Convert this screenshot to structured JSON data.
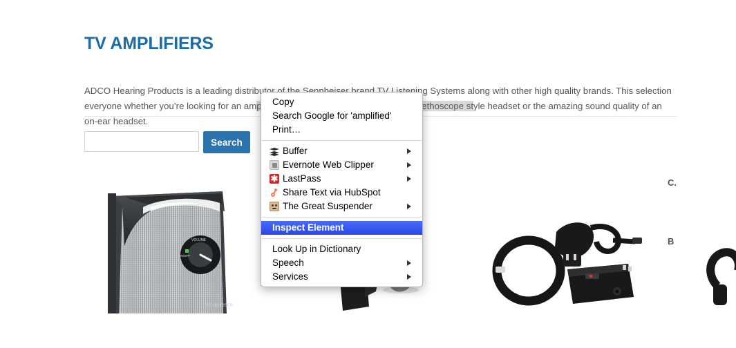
{
  "page": {
    "title": "TV AMPLIFIERS",
    "title_color": "#1c6ca8",
    "intro_before": "ADCO Hearing Products is a leading distributor of the Sennheiser brand TV Listening Systems along with other high quality brands. This selection everyone whether you’re looking for an am",
    "intro_selected": "plified speaker, a traditional headset, a stethoscope st",
    "intro_after": "yle headset or the amazing sound quality of an on-ear headset."
  },
  "search": {
    "value": "",
    "placeholder": "",
    "button_label": "Search",
    "button_color": "#2b73ae"
  },
  "products": [
    {
      "name": "tv-speaker",
      "title": ""
    },
    {
      "name": "headset-device",
      "title": ""
    },
    {
      "name": "transmitter-kit",
      "title": "C."
    },
    {
      "name": "headphone-set",
      "title": "B"
    }
  ],
  "context_menu": {
    "highlight_color": "#3a59ef",
    "groups": [
      {
        "items": [
          {
            "label": "Copy",
            "icon": null,
            "submenu": false,
            "highlighted": false
          },
          {
            "label": "Search Google for 'amplified'",
            "icon": null,
            "submenu": false,
            "highlighted": false
          },
          {
            "label": "Print…",
            "icon": null,
            "submenu": false,
            "highlighted": false
          }
        ]
      },
      {
        "items": [
          {
            "label": "Buffer",
            "icon": "buffer-icon",
            "submenu": true,
            "highlighted": false
          },
          {
            "label": "Evernote Web Clipper",
            "icon": "evernote-icon",
            "submenu": true,
            "highlighted": false
          },
          {
            "label": "LastPass",
            "icon": "lastpass-icon",
            "submenu": true,
            "highlighted": false
          },
          {
            "label": "Share Text via HubSpot",
            "icon": "hubspot-icon",
            "submenu": false,
            "highlighted": false
          },
          {
            "label": "The Great Suspender",
            "icon": "suspender-icon",
            "submenu": true,
            "highlighted": false
          }
        ]
      },
      {
        "items": [
          {
            "label": "Inspect Element",
            "icon": null,
            "submenu": false,
            "highlighted": true
          }
        ]
      },
      {
        "items": [
          {
            "label": "Look Up in Dictionary",
            "icon": null,
            "submenu": false,
            "highlighted": false
          },
          {
            "label": "Speech",
            "icon": null,
            "submenu": true,
            "highlighted": false
          },
          {
            "label": "Services",
            "icon": null,
            "submenu": true,
            "highlighted": false
          }
        ]
      }
    ]
  }
}
